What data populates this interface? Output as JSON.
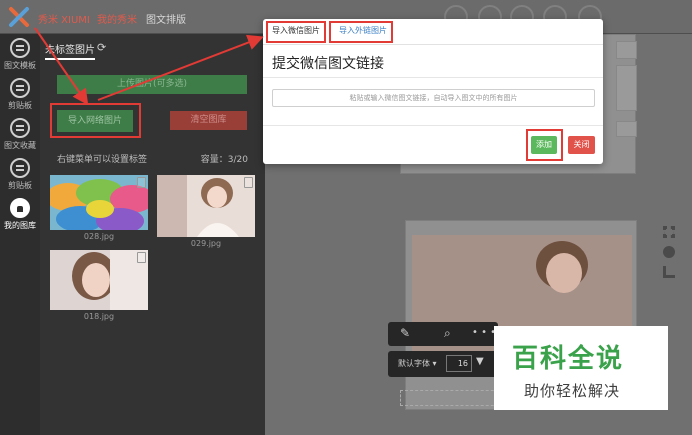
{
  "topbar": {
    "brand": "秀米 XIUMI",
    "nav": [
      "我的秀米",
      "图文排版"
    ]
  },
  "rail": {
    "items": [
      {
        "label": "图文模板",
        "icon": "template-icon"
      },
      {
        "label": "剪贴板",
        "icon": "clipboard-icon"
      },
      {
        "label": "图文收藏",
        "icon": "favorites-icon"
      },
      {
        "label": "剪贴板",
        "icon": "clipboard-alt-icon"
      },
      {
        "label": "我的图库",
        "icon": "gallery-icon"
      }
    ]
  },
  "panel": {
    "tab": "未标签图片",
    "upload": "上传图片(可多选)",
    "import": "导入网络图片",
    "clear": "清空图库",
    "hint": "右键菜单可以设置标签",
    "capacity": "容量：3/20",
    "images": [
      {
        "name": "028.jpg"
      },
      {
        "name": "029.jpg"
      },
      {
        "name": "018.jpg"
      }
    ]
  },
  "modal": {
    "tabs": [
      "导入微信图片",
      "导入外链图片"
    ],
    "title": "提交微信图文链接",
    "placeholder": "粘贴或输入微信图文链接，自动导入图文中的所有图片",
    "add": "添加",
    "close": "关闭"
  },
  "toolbar": {
    "font": "默认字体",
    "size": "16",
    "more": "• • •"
  },
  "watermark": {
    "main": "百科全说",
    "sub": "助你轻松解决"
  },
  "colors": {
    "accent_green": "#5cb85c",
    "danger_red": "#e0524a",
    "annotation_red": "#e23a35"
  }
}
